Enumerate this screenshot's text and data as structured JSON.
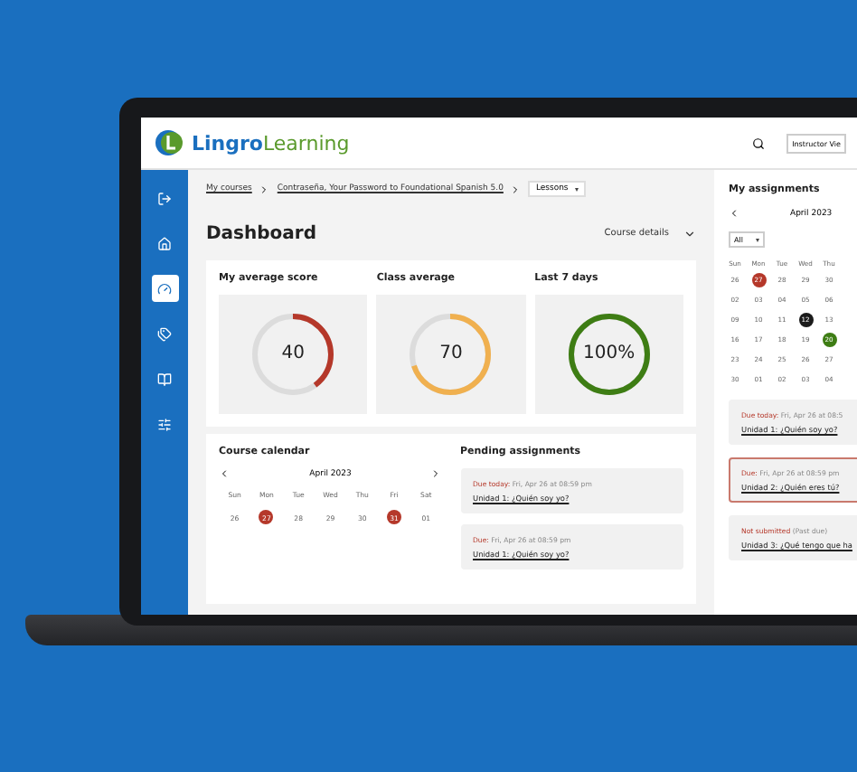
{
  "app": {
    "logo_text": "Lingro",
    "logo_text_2": "Learning",
    "view_button": "Instructor Vie"
  },
  "sidebar": {
    "items": [
      {
        "selected": false
      },
      {
        "selected": false
      },
      {
        "selected": true
      },
      {
        "selected": false
      },
      {
        "selected": false
      },
      {
        "selected": false
      }
    ]
  },
  "breadcrumb": {
    "items": [
      "My courses",
      "Contraseña, Your Password to Foundational Spanish 5.0"
    ],
    "select": "Lessons"
  },
  "title": "Dashboard",
  "course_details": "Course details",
  "scores": [
    {
      "label": "My average score",
      "value": "40",
      "color": "#b5382a"
    },
    {
      "label": "Class average",
      "value": "70",
      "color": "#f0b04f"
    },
    {
      "label": "Last 7 days",
      "value": "100%",
      "color": "#3e7d14"
    }
  ],
  "course_calendar": {
    "title": "Course calendar",
    "month": "April 2023",
    "weekdays": [
      "Sun",
      "Mon",
      "Tue",
      "Wed",
      "Thu",
      "Fri",
      "Sat"
    ],
    "days": [
      {
        "d": "26"
      },
      {
        "d": "27",
        "color": "#b5382a"
      },
      {
        "d": "28"
      },
      {
        "d": "29"
      },
      {
        "d": "30"
      },
      {
        "d": "31",
        "color": "#b5382a"
      },
      {
        "d": "01"
      }
    ]
  },
  "pending": {
    "title": "Pending assignments",
    "items": [
      {
        "status": "Due today:",
        "due": " Fri, Apr 26 at 08:59 pm",
        "link": "Unidad 1: ¿Quién soy yo?"
      },
      {
        "status": "Due:",
        "due": " Fri, Apr 26 at 08:59 pm",
        "link": "Unidad 1: ¿Quién soy yo?"
      }
    ]
  },
  "my_assignments": {
    "title": "My assignments",
    "month": "April 2023",
    "filter": "All",
    "weekdays": [
      "Sun",
      "Mon",
      "Tue",
      "Wed",
      "Thu"
    ],
    "weeks": [
      [
        {
          "d": "26"
        },
        {
          "d": "27",
          "color": "#b5382a"
        },
        {
          "d": "28"
        },
        {
          "d": "29"
        },
        {
          "d": "30"
        }
      ],
      [
        {
          "d": "02"
        },
        {
          "d": "03"
        },
        {
          "d": "04"
        },
        {
          "d": "05"
        },
        {
          "d": "06"
        }
      ],
      [
        {
          "d": "09"
        },
        {
          "d": "10"
        },
        {
          "d": "11"
        },
        {
          "d": "12",
          "color": "#1b1b1b"
        },
        {
          "d": "13"
        }
      ],
      [
        {
          "d": "16"
        },
        {
          "d": "17"
        },
        {
          "d": "18"
        },
        {
          "d": "19"
        },
        {
          "d": "20",
          "color": "#3e7d14"
        }
      ],
      [
        {
          "d": "23"
        },
        {
          "d": "24"
        },
        {
          "d": "25"
        },
        {
          "d": "26"
        },
        {
          "d": "27"
        }
      ],
      [
        {
          "d": "30"
        },
        {
          "d": "01"
        },
        {
          "d": "02"
        },
        {
          "d": "03"
        },
        {
          "d": "04"
        }
      ]
    ],
    "items": [
      {
        "status": "Due today:",
        "note": " Fri, Apr 26 at 08:5",
        "link": "Unidad 1: ¿Quién soy yo?",
        "selected": false
      },
      {
        "status": "Due:",
        "note": " Fri, Apr 26 at 08:59 pm",
        "link": "Unidad 2: ¿Quién eres tú?",
        "selected": true
      },
      {
        "status": "Not submitted",
        "note": " (Past due)",
        "link": "Unidad 3: ¿Qué tengo que ha",
        "selected": false
      }
    ]
  }
}
